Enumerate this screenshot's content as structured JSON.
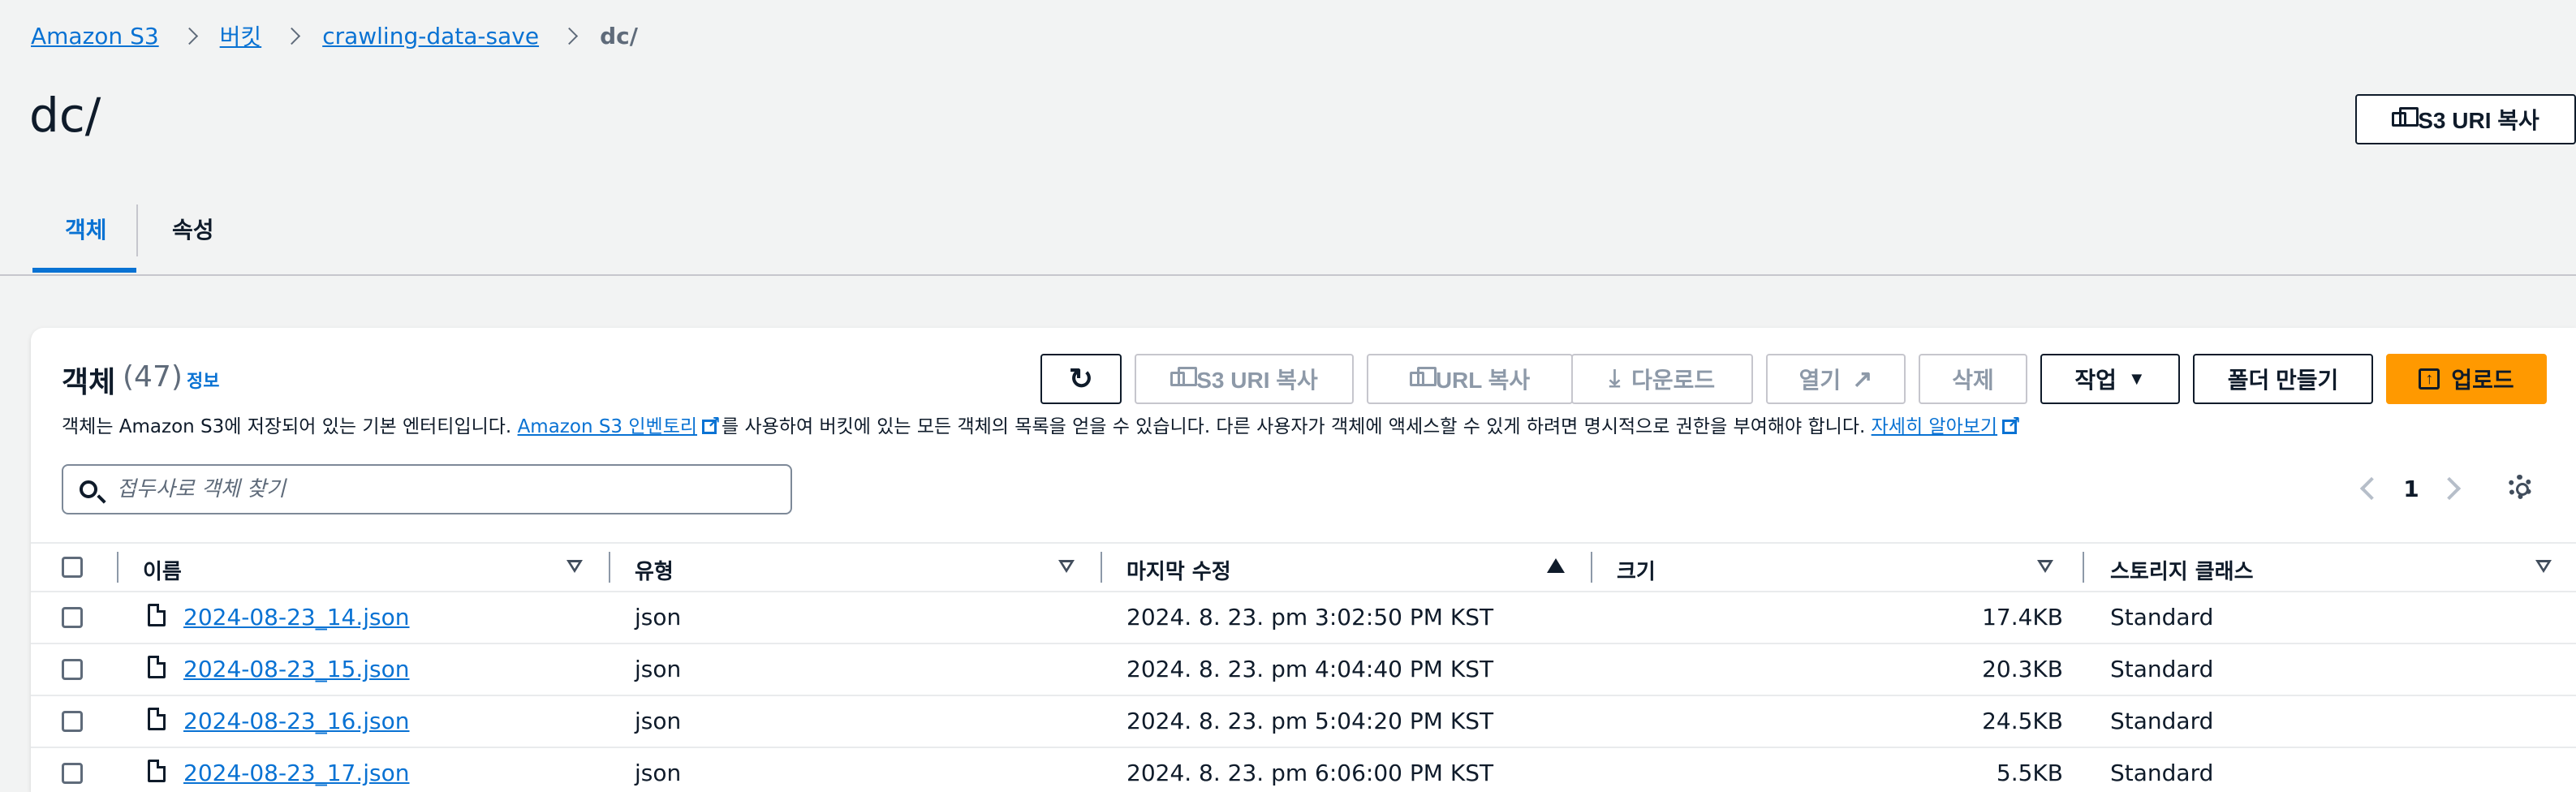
{
  "breadcrumb": {
    "items": [
      "Amazon S3",
      "버킷",
      "crawling-data-save"
    ],
    "current": "dc/"
  },
  "page": {
    "title": "dc/",
    "copy_uri_label": "S3 URI 복사"
  },
  "tabs": [
    "객체",
    "속성"
  ],
  "objects_panel": {
    "title": "객체",
    "count": "(47)",
    "info_label": "정보",
    "description_pre": "객체는 Amazon S3에 저장되어 있는 기본 엔터티입니다. ",
    "inventory_link": "Amazon S3 인벤토리",
    "description_mid": "를 사용하여 버킷에 있는 모든 객체의 목록을 얻을 수 있습니다. 다른 사용자가 객체에 액세스할 수 있게 하려면 명시적으로 권한을 부여해야 합니다. ",
    "learn_more_link": "자세히 알아보기",
    "toolbar": {
      "copy_uri": "S3 URI 복사",
      "copy_url": "URL 복사",
      "download": "다운로드",
      "open": "열기",
      "delete": "삭제",
      "actions": "작업",
      "create_folder": "폴더 만들기",
      "upload": "업로드"
    },
    "search": {
      "placeholder": "접두사로 객체 찾기"
    },
    "pagination": {
      "current_page": "1"
    }
  },
  "table": {
    "columns": [
      "이름",
      "유형",
      "마지막 수정",
      "크기",
      "스토리지 클래스"
    ],
    "rows": [
      {
        "name": "2024-08-23_14.json",
        "type": "json",
        "modified": "2024. 8. 23. pm 3:02:50 PM KST",
        "size": "17.4KB",
        "storage": "Standard"
      },
      {
        "name": "2024-08-23_15.json",
        "type": "json",
        "modified": "2024. 8. 23. pm 4:04:40 PM KST",
        "size": "20.3KB",
        "storage": "Standard"
      },
      {
        "name": "2024-08-23_16.json",
        "type": "json",
        "modified": "2024. 8. 23. pm 5:04:20 PM KST",
        "size": "24.5KB",
        "storage": "Standard"
      },
      {
        "name": "2024-08-23_17.json",
        "type": "json",
        "modified": "2024. 8. 23. pm 6:06:00 PM KST",
        "size": "5.5KB",
        "storage": "Standard"
      }
    ]
  },
  "colors": {
    "link": "#0972d3",
    "primary_button": "#ff9900",
    "text": "#0f1b2a",
    "background": "#f2f3f3"
  }
}
